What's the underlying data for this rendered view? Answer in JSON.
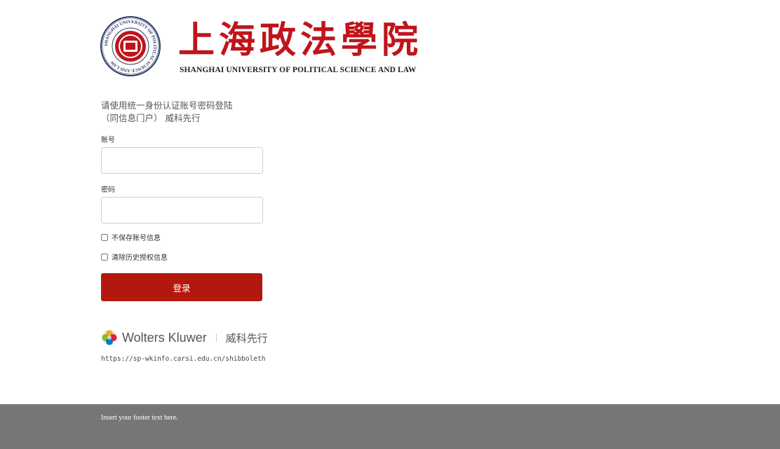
{
  "logo": {
    "seal_text": "SHANGHAI UNIVERSITY OF POLITICAL SCIENCE AND LAW",
    "cn_name": "上海政法學院",
    "en_name": "SHANGHAI UNIVERSITY OF POLITICAL SCIENCE AND LAW",
    "color": "#c0141c"
  },
  "login": {
    "intro_line1": "请使用统一身份认证账号密码登陆",
    "intro_line2": "（同信息门户） 威科先行",
    "username_label": "账号",
    "username_value": "",
    "password_label": "密码",
    "password_value": "",
    "dont_save_label": "不保存账号信息",
    "clear_history_label": "清除历史授权信息",
    "submit_label": "登录",
    "button_color": "#b3180e"
  },
  "provider": {
    "brand_name": "Wolters Kluwer",
    "brand_cn": "威科先行",
    "sp_url": "https://sp-wkinfo.carsi.edu.cn/shibboleth"
  },
  "footer": {
    "text": "Insert your footer text here.",
    "color": "#767676"
  }
}
